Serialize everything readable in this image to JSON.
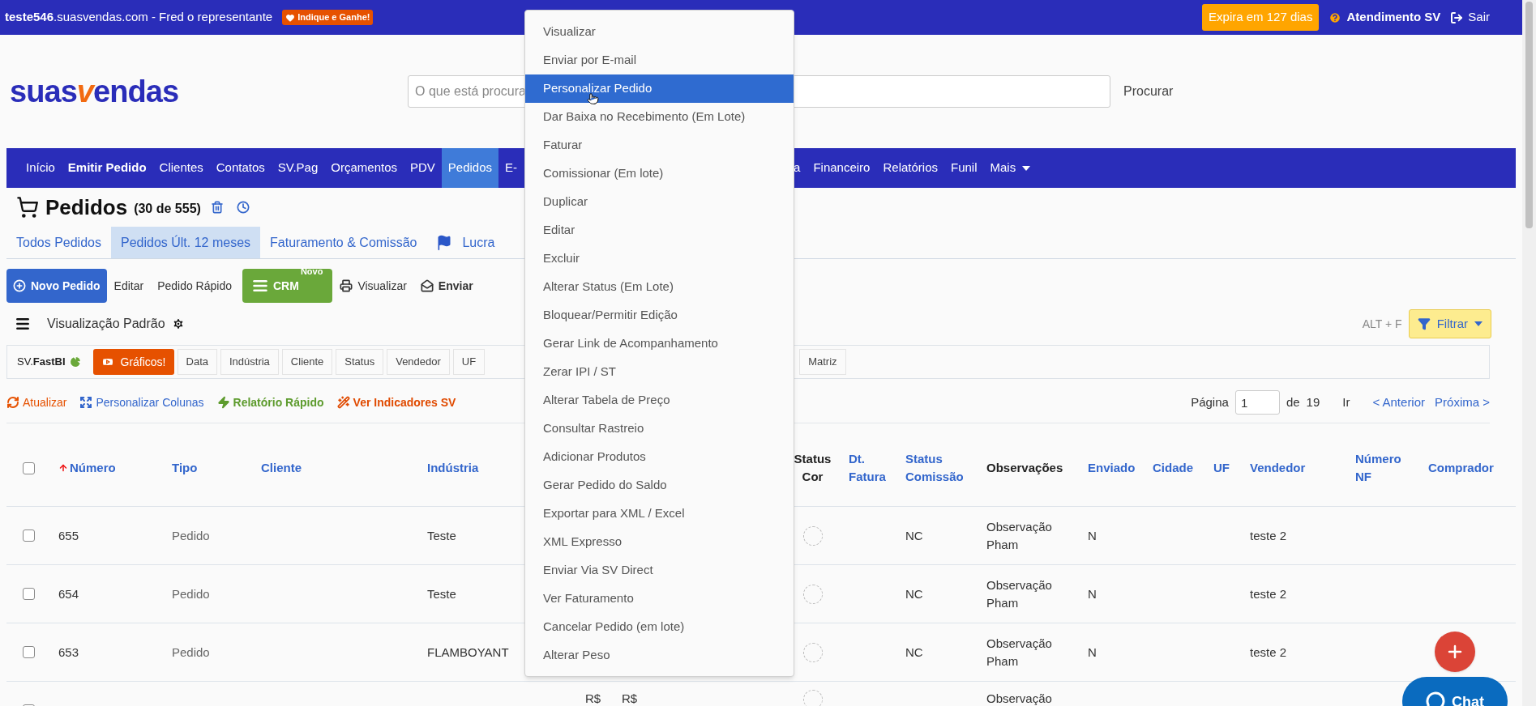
{
  "top_bar": {
    "site": "**teste546**.suasvendas.com - Fred o representante",
    "promo_badge": "Indique e Ganhe!",
    "expiry_badge": "Expira em 127 dias",
    "support": "Atendimento SV",
    "logout": "Sair"
  },
  "logo": [
    {
      "text": "suas",
      "accent": false
    },
    {
      "text": "v",
      "accent": true
    },
    {
      "text": "endas",
      "accent": false
    }
  ],
  "search": {
    "placeholder": "O que está procura",
    "button": "Procurar"
  },
  "nav": {
    "left": [
      {
        "label": "Início",
        "selected": false,
        "kind": "link"
      },
      {
        "label": "Emitir Pedido",
        "selected": false,
        "kind": "strong"
      },
      {
        "label": "Clientes",
        "selected": false,
        "kind": "link"
      },
      {
        "label": "Contatos",
        "selected": false,
        "kind": "link"
      },
      {
        "label": "SV.Pag",
        "selected": false,
        "kind": "link"
      },
      {
        "label": "Orçamentos",
        "selected": false,
        "kind": "link"
      },
      {
        "label": "PDV",
        "selected": false,
        "kind": "link"
      },
      {
        "label": "Pedidos",
        "selected": true,
        "kind": "link"
      },
      {
        "label": "E-",
        "selected": false,
        "kind": "link"
      }
    ],
    "right": [
      {
        "label": "a",
        "selected": false,
        "kind": "link"
      },
      {
        "label": "Financeiro",
        "selected": false,
        "kind": "link"
      },
      {
        "label": "Relatórios",
        "selected": false,
        "kind": "link"
      },
      {
        "label": "Funil",
        "selected": false,
        "kind": "link"
      },
      {
        "label": "Mais",
        "selected": false,
        "kind": "dropdown"
      }
    ]
  },
  "page": {
    "title": "Pedidos",
    "count": "(30 de 555)"
  },
  "tabs": [
    {
      "label": "Todos Pedidos",
      "selected": false,
      "kind": "plain"
    },
    {
      "label": "Pedidos Últ. 12 meses",
      "selected": true,
      "kind": "plain"
    },
    {
      "label": "Faturamento & Comissão",
      "selected": false,
      "kind": "plain"
    },
    {
      "label": "Lucra",
      "selected": false,
      "kind": "flag"
    }
  ],
  "toolbar": [
    {
      "kind": "primary",
      "label": "Novo Pedido"
    },
    {
      "kind": "plain",
      "label": "Editar"
    },
    {
      "kind": "plain",
      "label": "Pedido Rápido"
    },
    {
      "kind": "crm",
      "label": "CRM",
      "badge": "Novo"
    },
    {
      "kind": "print",
      "label": "Visualizar"
    },
    {
      "kind": "send",
      "label": "Enviar"
    }
  ],
  "view": {
    "label": "Visualização Padrão",
    "shortcut": "ALT + F",
    "filter_button": "Filtrar"
  },
  "fastbi": {
    "brand": "SV.**FastBI**",
    "charts_button": "Gráficos!",
    "chips_left": [
      "Data",
      "Indústria",
      "Cliente",
      "Status",
      "Vendedor",
      "UF"
    ],
    "chips_right": [
      "Matriz"
    ]
  },
  "actions": [
    {
      "kind": "refresh",
      "label": "Atualizar"
    },
    {
      "kind": "columns",
      "label": "Personalizar Colunas"
    },
    {
      "kind": "report",
      "label": "Relatório Rápido"
    },
    {
      "kind": "indicators",
      "label": "Ver Indicadores SV"
    }
  ],
  "pagination": {
    "page_label": "Página",
    "page_value": "1",
    "of_label": "de",
    "total": "19",
    "go": "Ir",
    "prev": "< Anterior",
    "next": "Próxima >"
  },
  "table": {
    "select_all_checked": false,
    "columns": [
      {
        "kind": "checkbox"
      },
      {
        "label": "Número",
        "kind": "link",
        "sorted": true
      },
      {
        "label": "Tipo",
        "kind": "link",
        "sorted": false
      },
      {
        "label": "Cliente",
        "kind": "link",
        "sorted": false
      },
      {
        "label": "Indústria",
        "kind": "link",
        "sorted": false
      },
      {
        "kind": "hidden"
      },
      {
        "kind": "hidden"
      },
      {
        "label": "Status Cor",
        "kind": "swatch",
        "sorted": false
      },
      {
        "label": "Dt. Fatura",
        "kind": "link",
        "sorted": false
      },
      {
        "label": "Status Comissão",
        "kind": "link",
        "sorted": false
      },
      {
        "label": "Observações",
        "kind": "plain",
        "sorted": false
      },
      {
        "label": "Enviado",
        "kind": "link",
        "sorted": false
      },
      {
        "label": "Cidade",
        "kind": "link",
        "sorted": false
      },
      {
        "label": "UF",
        "kind": "link",
        "sorted": false
      },
      {
        "label": "Vendedor",
        "kind": "link",
        "sorted": false
      },
      {
        "label": "Número NF",
        "kind": "link",
        "sorted": false
      },
      {
        "label": "Comprador",
        "kind": "link",
        "sorted": false
      }
    ],
    "rows": [
      {
        "checked": false,
        "kind": "full",
        "cells": [
          null,
          "655",
          "Pedido",
          null,
          "Teste",
          null,
          null,
          null,
          null,
          "NC",
          "Observação Pham",
          "N",
          null,
          null,
          "teste 2",
          null,
          null
        ]
      },
      {
        "checked": false,
        "kind": "full",
        "cells": [
          null,
          "654",
          "Pedido",
          null,
          "Teste",
          null,
          null,
          null,
          null,
          "NC",
          "Observação Pham",
          "N",
          null,
          null,
          "teste 2",
          null,
          null
        ]
      },
      {
        "checked": false,
        "kind": "full",
        "cells": [
          null,
          "653",
          "Pedido",
          null,
          "FLAMBOYANT",
          null,
          null,
          null,
          null,
          "NC",
          "Observação Pham",
          "N",
          null,
          null,
          "teste 2",
          null,
          null
        ]
      },
      {
        "checked": false,
        "kind": "partial",
        "cells": [
          null,
          null,
          null,
          null,
          null,
          "R$",
          "R$",
          null,
          null,
          null,
          "Observação",
          null,
          null,
          null,
          null,
          null,
          null
        ]
      }
    ]
  },
  "menu": {
    "items": [
      {
        "label": "Visualizar",
        "selected": false
      },
      {
        "label": "Enviar por E-mail",
        "selected": false
      },
      {
        "label": "Personalizar Pedido",
        "selected": true
      },
      {
        "label": "Dar Baixa no Recebimento (Em Lote)",
        "selected": false
      },
      {
        "label": "Faturar",
        "selected": false
      },
      {
        "label": "Comissionar (Em lote)",
        "selected": false
      },
      {
        "label": "Duplicar",
        "selected": false
      },
      {
        "label": "Editar",
        "selected": false
      },
      {
        "label": "Excluir",
        "selected": false
      },
      {
        "label": "Alterar Status (Em Lote)",
        "selected": false
      },
      {
        "label": "Bloquear/Permitir Edição",
        "selected": false
      },
      {
        "label": "Gerar Link de Acompanhamento",
        "selected": false
      },
      {
        "label": "Zerar IPI / ST",
        "selected": false
      },
      {
        "label": "Alterar Tabela de Preço",
        "selected": false
      },
      {
        "label": "Consultar Rastreio",
        "selected": false
      },
      {
        "label": "Adicionar Produtos",
        "selected": false
      },
      {
        "label": "Gerar Pedido do Saldo",
        "selected": false
      },
      {
        "label": "Exportar para XML / Excel",
        "selected": false
      },
      {
        "label": "XML Expresso",
        "selected": false
      },
      {
        "label": "Enviar Via SV Direct",
        "selected": false
      },
      {
        "label": "Ver Faturamento",
        "selected": false
      },
      {
        "label": "Cancelar Pedido (em lote)",
        "selected": false
      },
      {
        "label": "Alterar Peso",
        "selected": false
      }
    ]
  },
  "chat_button": "Chat"
}
